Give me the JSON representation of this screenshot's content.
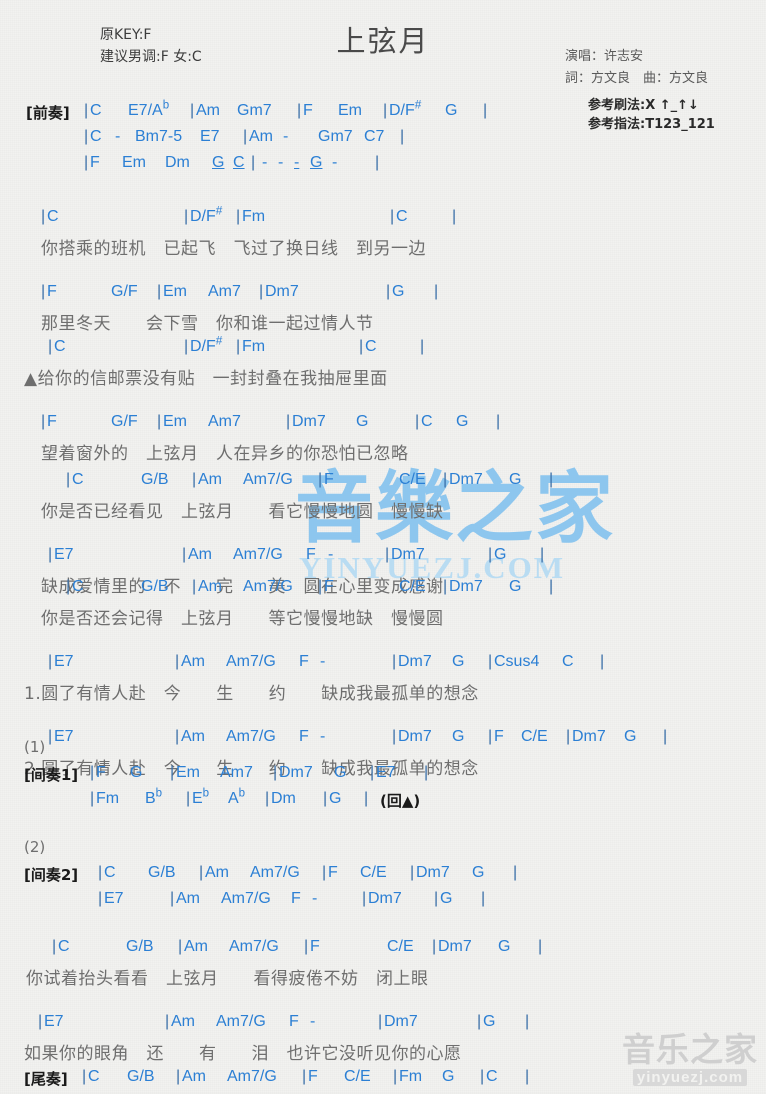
{
  "meta": {
    "title": "上弦月",
    "original_key_label": "原KEY:F",
    "suggested_key_label": "建议男调:F 女:C",
    "singer_label": "演唱：许志安",
    "writer_label": "詞：方文良　曲：方文良",
    "strum_label": "参考刷法:X ↑_↑↓",
    "finger_label": "参考指法:T123_121",
    "chord_color": "#2b7fd4",
    "lyric_color": "#6e6e6e",
    "label_color": "#1a1a1a"
  },
  "watermarks": {
    "center_cn": "音樂之家",
    "center_en": "YINYUEZJ.COM",
    "corner_cn": "音乐之家",
    "corner_en": "yinyuezj.com"
  },
  "sections": {
    "intro_label": "[前奏]",
    "interlude1_label": "[间奏1]",
    "interlude2_label": "[间奏2]",
    "outro_label": "[尾奏]",
    "ending1_marker": "(1)",
    "ending2_marker": "(2)",
    "repeat_marker": "(回▲)",
    "verse3_marker": "▲",
    "verse_num1": "1.",
    "verse_num2": "2."
  },
  "chords": {
    "C": "C",
    "G": "G",
    "Am": "Am",
    "Em": "Em",
    "Dm": "Dm",
    "F": "F",
    "E7": "E7",
    "Gm7": "Gm7",
    "Am7": "Am7",
    "Dm7": "Dm7",
    "C7": "C7",
    "Bm7b5": "Bm7-5",
    "E7_Ab": "E7/A",
    "D_Fs": "D/F",
    "Fm": "Fm",
    "G_F": "G/F",
    "G_B": "G/B",
    "Am7_G": "Am7/G",
    "C_E": "C/E",
    "Csus4": "Csus4",
    "Bb": "B",
    "Eb": "E",
    "Ab": "A",
    "flat": "b",
    "sharp": "#",
    "bar": "|",
    "dash": "-"
  },
  "lyrics": {
    "v1l1": "你搭乘的班机　已起飞　飞过了换日线　到另一边",
    "v1l2": "那里冬天　　会下雪　你和谁一起过情人节",
    "v2l1": "给你的信邮票没有贴　一封封叠在我抽屉里面",
    "v2l2": "望着窗外的　上弦月　人在异乡的你恐怕已忽略",
    "c1l1": "你是否已经看见　上弦月　　看它慢慢地圆　慢慢缺",
    "c1l2": "缺成爱情里的　不　　完　　美　圆在心里变成感谢",
    "c2l1": "你是否还会记得　上弦月　　等它慢慢地缺　慢慢圆",
    "c2l2": "圆了有情人赴　今　　生　　约　　缺成我最孤单的想念",
    "c2l2b": "圆了有情人赴　今　　生　　约　　缺成我最孤单的想念",
    "v3l1": "你试着抬头看看　上弦月　　看得疲倦不妨　闭上眼",
    "v3l2": "如果你的眼角　还　　有　　泪　也许它没听见你的心愿"
  }
}
